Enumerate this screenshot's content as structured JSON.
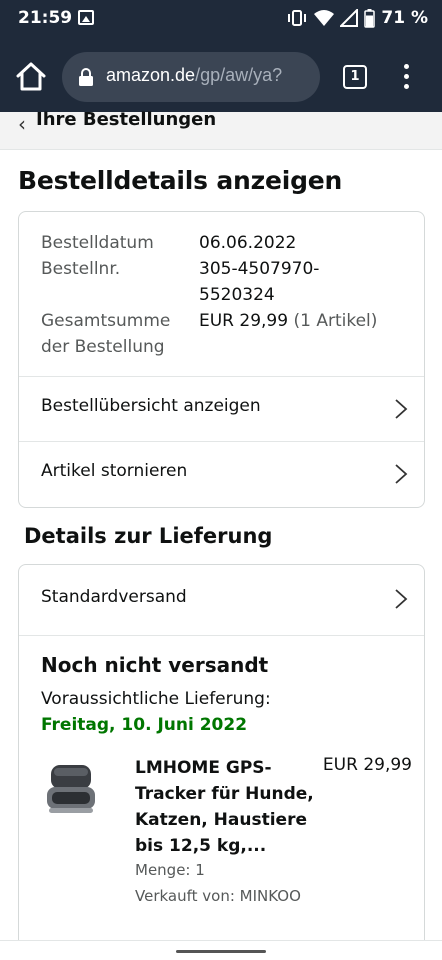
{
  "status_bar": {
    "time": "21:59",
    "battery": "71 %",
    "battery_level": 0.71
  },
  "browser": {
    "url_host": "amazon.de",
    "url_path": "/gp/aw/ya?",
    "tab_count": "1"
  },
  "breadcrumb": {
    "label": "Ihre Bestellungen"
  },
  "page": {
    "title": "Bestelldetails anzeigen"
  },
  "order_summary": {
    "date_label": "Bestelldatum",
    "date_value": "06.06.2022",
    "number_label": "Bestellnr.",
    "number_value_line1": "305-4507970-",
    "number_value_line2": "5520324",
    "total_label_line1": "Gesamtsumme",
    "total_label_line2": "der Bestellung",
    "total_value": "EUR 29,99",
    "total_items": "(1 Artikel)",
    "links": [
      {
        "label": "Bestellübersicht anzeigen"
      },
      {
        "label": "Artikel stornieren"
      }
    ]
  },
  "delivery": {
    "section_title": "Details zur Lieferung",
    "shipping_method": "Standardversand",
    "status": "Noch nicht versandt",
    "estimated_label": "Voraussichtliche Lieferung:",
    "estimated_date": "Freitag, 10. Juni 2022",
    "product": {
      "name_lines": [
        "LMHOME GPS-",
        "Tracker für Hunde,",
        "Katzen, Haustiere",
        "bis 12,5 kg,..."
      ],
      "price": "EUR 29,99",
      "quantity": "Menge: 1",
      "seller": "Verkauft von: MINKOO"
    }
  },
  "colors": {
    "chrome_bg": "#1f2a3a",
    "url_bg": "#3b4554",
    "delivery_green": "#007600",
    "border": "#d5d9d9"
  }
}
